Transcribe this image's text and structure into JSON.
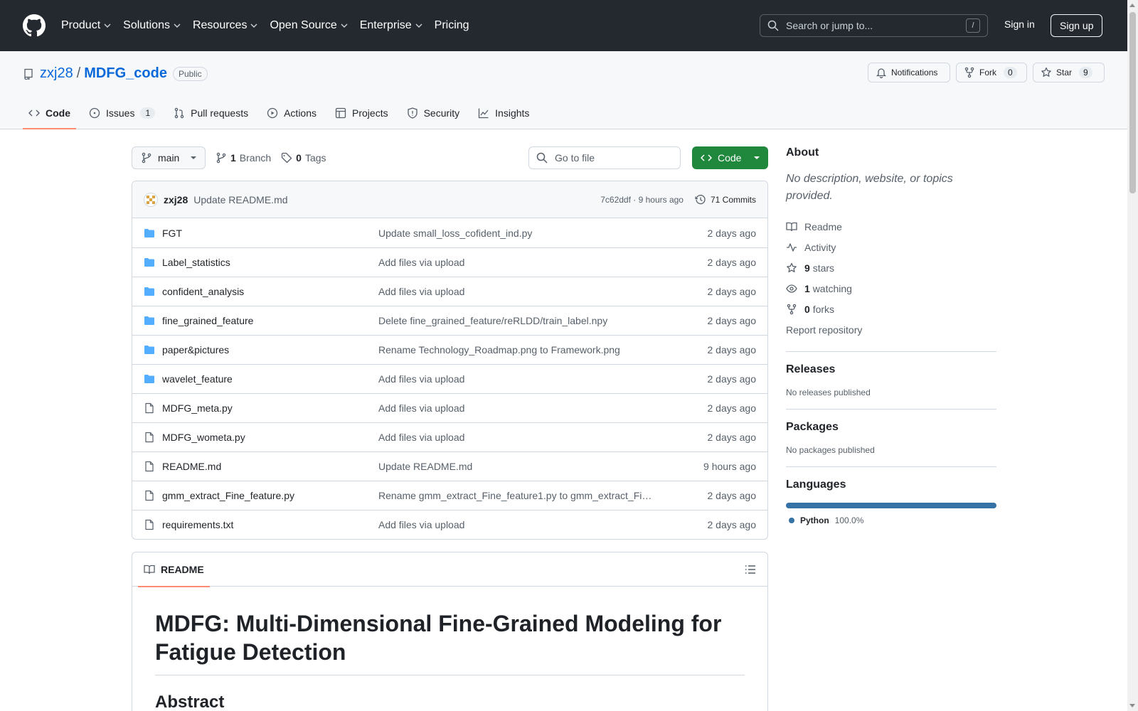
{
  "header": {
    "nav": [
      "Product",
      "Solutions",
      "Resources",
      "Open Source",
      "Enterprise",
      "Pricing"
    ],
    "search_placeholder": "Search or jump to...",
    "search_key": "/",
    "sign_in": "Sign in",
    "sign_up": "Sign up"
  },
  "repo": {
    "owner": "zxj28",
    "separator": "/",
    "name": "MDFG_code",
    "visibility": "Public",
    "notifications_label": "Notifications",
    "fork_label": "Fork",
    "fork_count": "0",
    "star_label": "Star",
    "star_count": "9"
  },
  "tabs": [
    {
      "label": "Code",
      "active": true
    },
    {
      "label": "Issues",
      "count": "1"
    },
    {
      "label": "Pull requests"
    },
    {
      "label": "Actions"
    },
    {
      "label": "Projects"
    },
    {
      "label": "Security"
    },
    {
      "label": "Insights"
    }
  ],
  "branch": {
    "name": "main",
    "branches_count": "1",
    "branches_label": "Branch",
    "tags_count": "0",
    "tags_label": "Tags",
    "goto_placeholder": "Go to file",
    "code_button": "Code"
  },
  "latest_commit": {
    "user": "zxj28",
    "message": "Update README.md",
    "sha_time": "7c62ddf · 9 hours ago",
    "commits_label": "71 Commits"
  },
  "files": [
    {
      "name": "FGT",
      "type": "dir",
      "message": "Update small_loss_cofident_ind.py",
      "date": "2 days ago"
    },
    {
      "name": "Label_statistics",
      "type": "dir",
      "message": "Add files via upload",
      "date": "2 days ago"
    },
    {
      "name": "confident_analysis",
      "type": "dir",
      "message": "Add files via upload",
      "date": "2 days ago"
    },
    {
      "name": "fine_grained_feature",
      "type": "dir",
      "message": "Delete fine_grained_feature/reRLDD/train_label.npy",
      "date": "2 days ago"
    },
    {
      "name": "paper&pictures",
      "type": "dir",
      "message": "Rename Technology_Roadmap.png to Framework.png",
      "date": "2 days ago"
    },
    {
      "name": "wavelet_feature",
      "type": "dir",
      "message": "Add files via upload",
      "date": "2 days ago"
    },
    {
      "name": "MDFG_meta.py",
      "type": "file",
      "message": "Add files via upload",
      "date": "2 days ago"
    },
    {
      "name": "MDFG_wometa.py",
      "type": "file",
      "message": "Add files via upload",
      "date": "2 days ago"
    },
    {
      "name": "README.md",
      "type": "file",
      "message": "Update README.md",
      "date": "9 hours ago"
    },
    {
      "name": "gmm_extract_Fine_feature.py",
      "type": "file",
      "message": "Rename gmm_extract_Fine_feature1.py to gmm_extract_Fi…",
      "date": "2 days ago"
    },
    {
      "name": "requirements.txt",
      "type": "file",
      "message": "Add files via upload",
      "date": "2 days ago"
    }
  ],
  "readme": {
    "tab_label": "README",
    "title": "MDFG: Multi-Dimensional Fine-Grained Modeling for Fatigue Detection",
    "section": "Abstract"
  },
  "sidebar": {
    "about_title": "About",
    "description": "No description, website, or topics provided.",
    "links": [
      {
        "icon": "book-icon",
        "bold": "",
        "text": "Readme"
      },
      {
        "icon": "pulse-icon",
        "bold": "",
        "text": "Activity"
      },
      {
        "icon": "star-icon",
        "bold": "9",
        "text": "stars"
      },
      {
        "icon": "eye-icon",
        "bold": "1",
        "text": "watching"
      },
      {
        "icon": "fork-icon",
        "bold": "0",
        "text": "forks"
      }
    ],
    "report": "Report repository",
    "releases_title": "Releases",
    "releases_text": "No releases published",
    "packages_title": "Packages",
    "packages_text": "No packages published",
    "languages_title": "Languages",
    "languages": [
      {
        "name": "Python",
        "percent": "100.0%",
        "color": "#3572A5"
      }
    ]
  },
  "colors": {
    "header_bg": "#24292f",
    "link": "#0969da",
    "code_button": "#1f883d",
    "active_tab": "#fd8c73"
  }
}
